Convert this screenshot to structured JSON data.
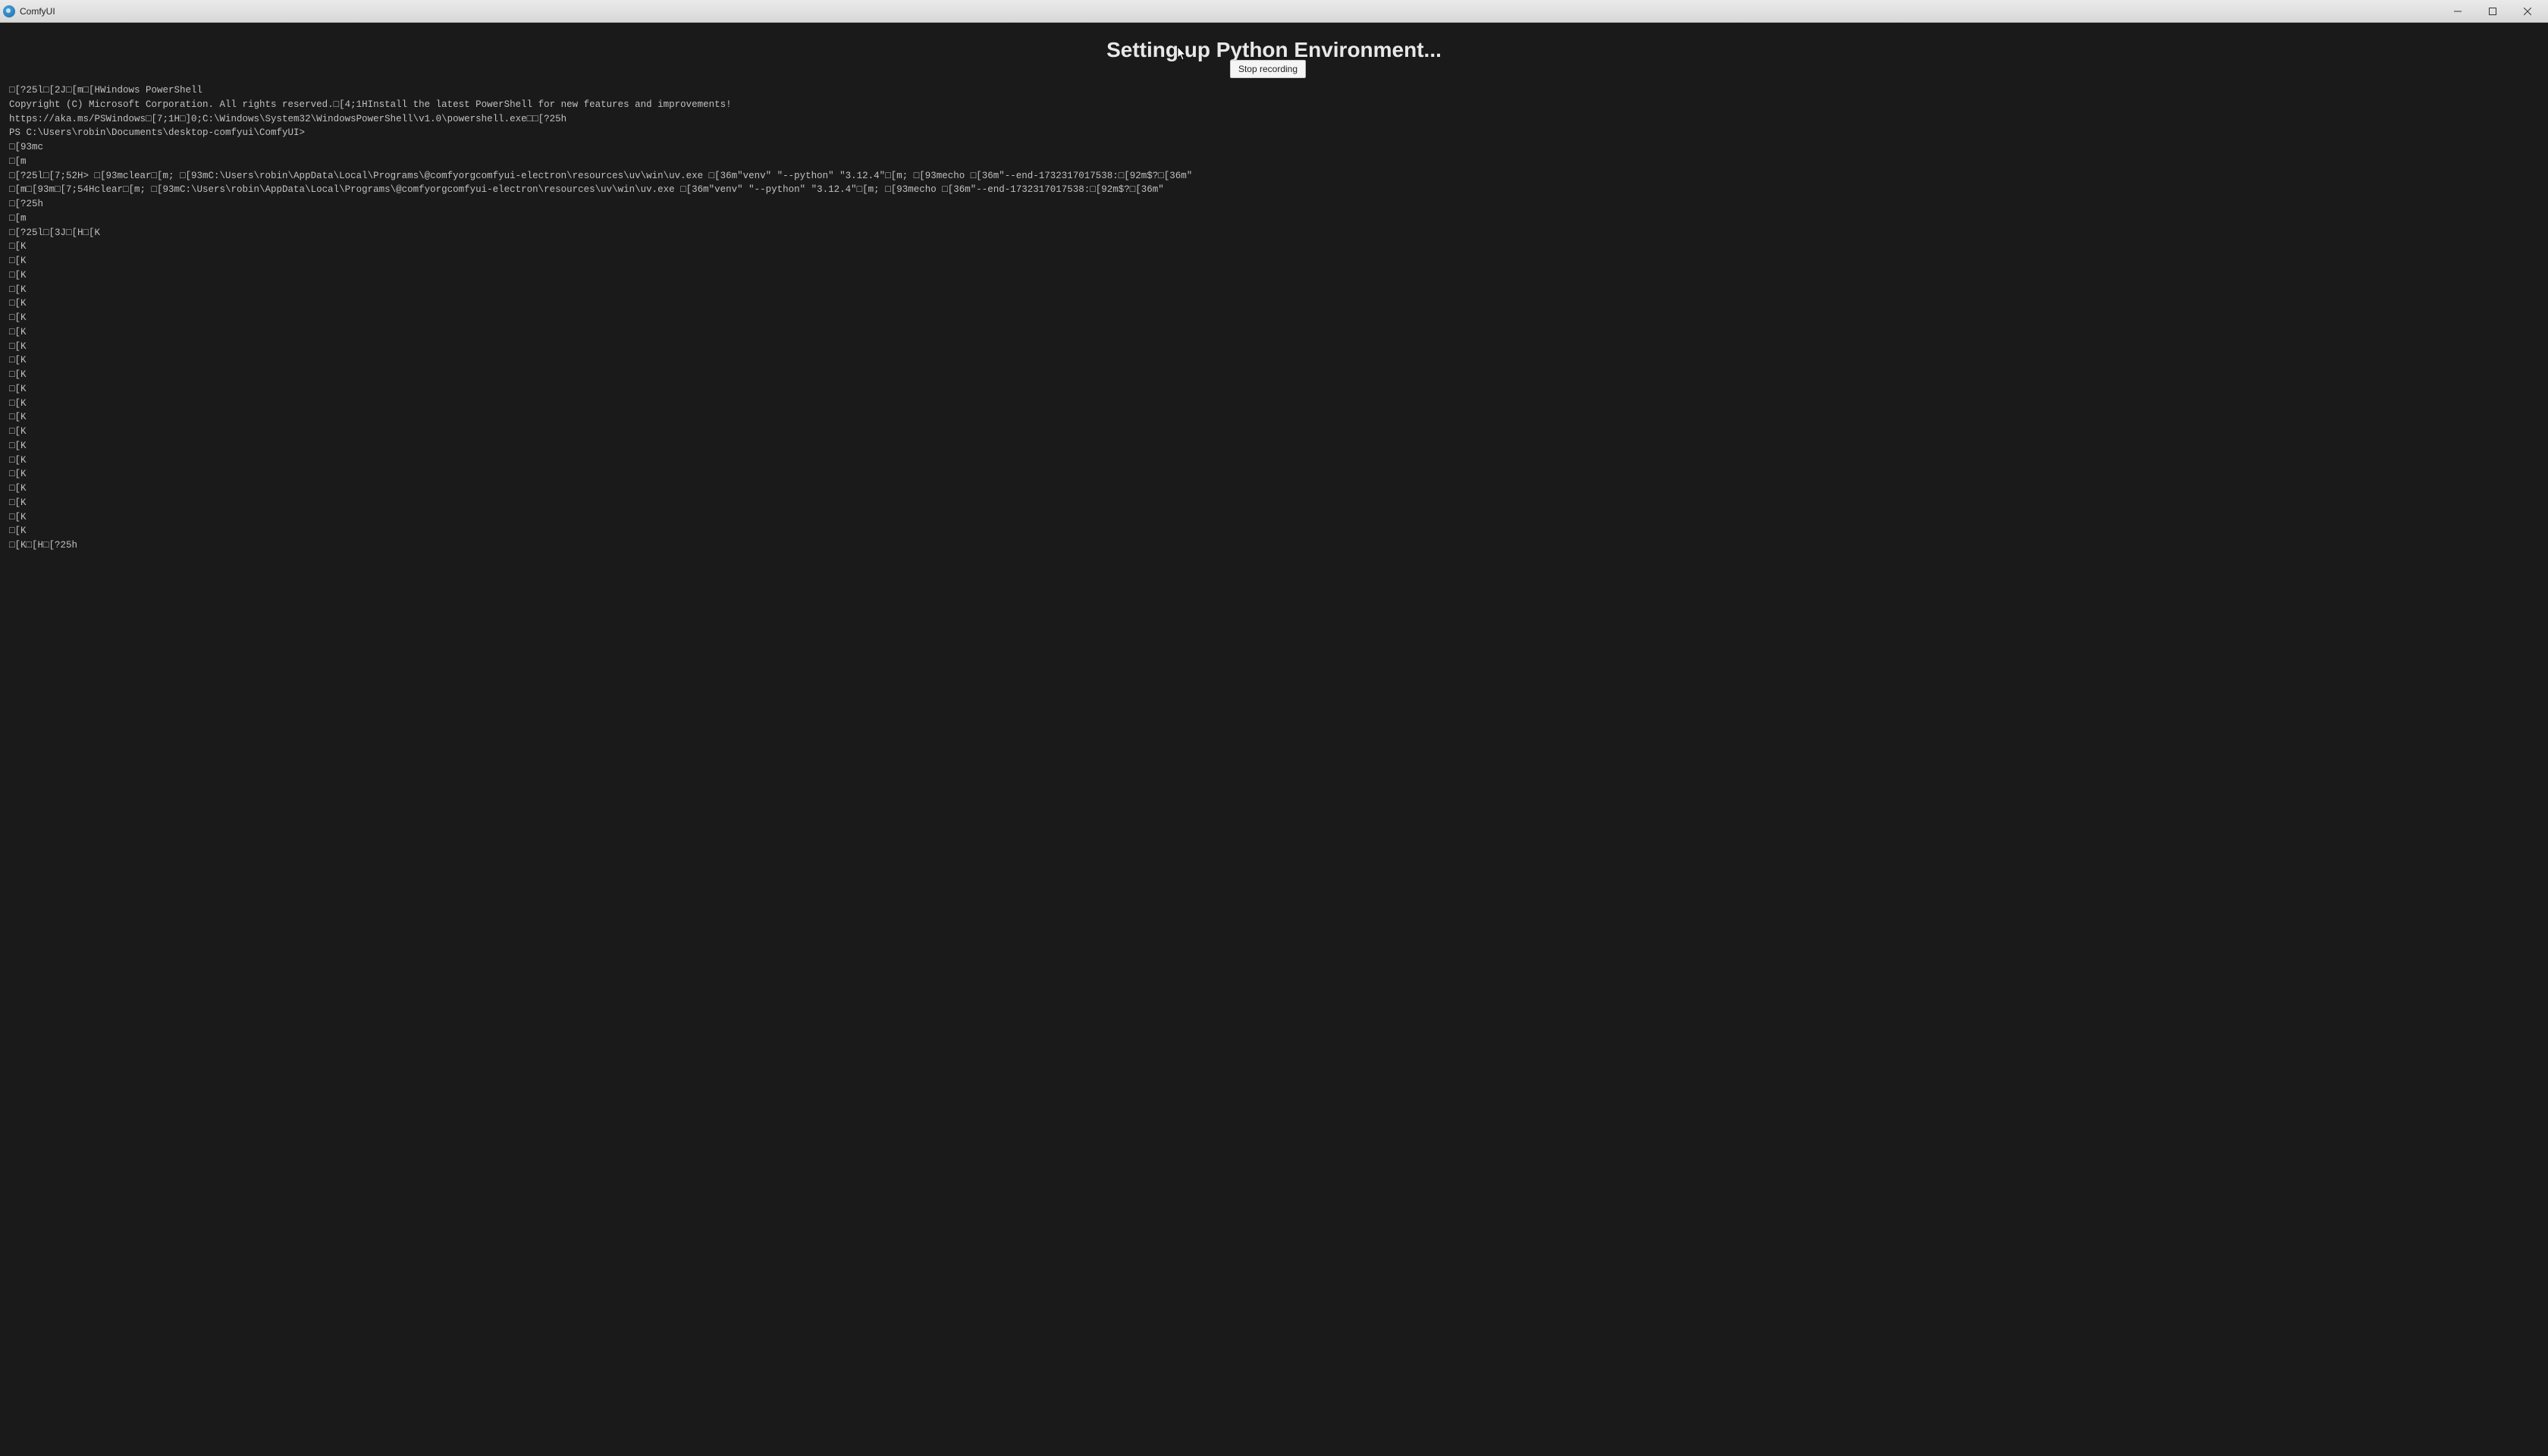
{
  "window": {
    "title": "ComfyUI"
  },
  "main": {
    "heading": "Setting up Python Environment..."
  },
  "tooltip": {
    "text": "Stop recording"
  },
  "terminal": {
    "lines": [
      "□[?25l□[2J□[m□[HWindows PowerShell",
      "Copyright (C) Microsoft Corporation. All rights reserved.□[4;1HInstall the latest PowerShell for new features and improvements!",
      "https://aka.ms/PSWindows□[7;1H□]0;C:\\Windows\\System32\\WindowsPowerShell\\v1.0\\powershell.exe□□[?25h",
      "PS C:\\Users\\robin\\Documents\\desktop-comfyui\\ComfyUI>",
      "□[93mc",
      "□[m",
      "□[?25l□[7;52H> □[93mclear□[m; □[93mC:\\Users\\robin\\AppData\\Local\\Programs\\@comfyorgcomfyui-electron\\resources\\uv\\win\\uv.exe □[36m\"venv\" \"--python\" \"3.12.4\"□[m; □[93mecho □[36m\"--end-1732317017538:□[92m$?□[36m\"",
      "□[m□[93m□[7;54Hclear□[m; □[93mC:\\Users\\robin\\AppData\\Local\\Programs\\@comfyorgcomfyui-electron\\resources\\uv\\win\\uv.exe □[36m\"venv\" \"--python\" \"3.12.4\"□[m; □[93mecho □[36m\"--end-1732317017538:□[92m$?□[36m\"",
      "□[?25h",
      "□[m",
      "□[?25l□[3J□[H□[K",
      "□[K",
      "□[K",
      "□[K",
      "□[K",
      "□[K",
      "□[K",
      "□[K",
      "□[K",
      "□[K",
      "□[K",
      "□[K",
      "□[K",
      "□[K",
      "□[K",
      "□[K",
      "□[K",
      "□[K",
      "□[K",
      "□[K",
      "□[K",
      "□[K",
      "□[K□[H□[?25h"
    ]
  }
}
